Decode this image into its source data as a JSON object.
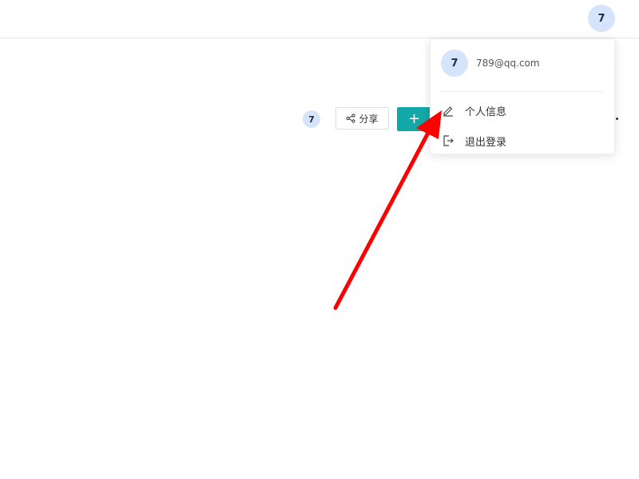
{
  "topbar": {
    "avatar_text": "7"
  },
  "toolbar": {
    "member_avatar_text": "7",
    "share_label": "分享",
    "create_label": "+"
  },
  "user_menu": {
    "avatar_text": "7",
    "email": "789@qq.com",
    "items": [
      {
        "label": "个人信息",
        "icon": "edit-pencil-icon"
      },
      {
        "label": "退出登录",
        "icon": "logout-icon"
      }
    ]
  },
  "colors": {
    "avatar_bg": "#d6e4fb",
    "primary_button": "#13a8a8",
    "annotation_arrow": "#ff0000"
  }
}
